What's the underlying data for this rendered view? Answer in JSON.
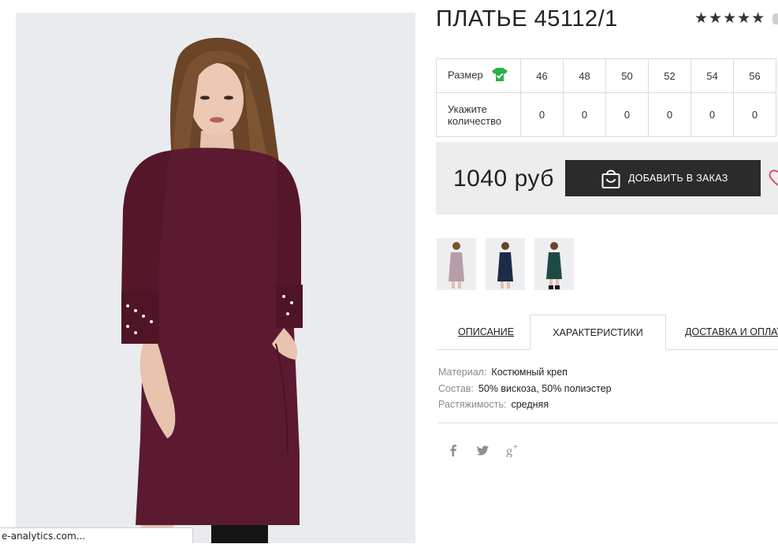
{
  "product": {
    "title": "ПЛАТЬЕ 45112/1",
    "rating_stars": "★★★★★",
    "rating_value": 5,
    "rating_max": 5
  },
  "size_table": {
    "size_label": "Размер",
    "qty_label_line1": "Укажите",
    "qty_label_line2": "количество",
    "sizes": [
      "46",
      "48",
      "50",
      "52",
      "54",
      "56"
    ],
    "quantities": [
      "0",
      "0",
      "0",
      "0",
      "0",
      "0"
    ],
    "size_icon": "tshirt-check-icon"
  },
  "purchase": {
    "price": "1040 руб",
    "add_button_label": "ДОБАВИТЬ В ЗАКАЗ",
    "add_button_icon": "shopping-bag-icon",
    "wishlist_icon": "heart-icon"
  },
  "thumbnails": [
    {
      "name": "thumb-mauve",
      "color": "#b59ea8"
    },
    {
      "name": "thumb-navy",
      "color": "#1f2a48"
    },
    {
      "name": "thumb-green",
      "color": "#1f4a44"
    }
  ],
  "tabs": [
    {
      "label": "ОПИСАНИЕ",
      "active": false
    },
    {
      "label": "ХАРАКТЕРИСТИКИ",
      "active": true
    },
    {
      "label": "ДОСТАВКА И ОПЛАТА",
      "active": false
    }
  ],
  "characteristics": [
    {
      "key": "Материал:",
      "value": "Костюмный креп"
    },
    {
      "key": "Состав:",
      "value": "50% вискоза, 50% полиэстер"
    },
    {
      "key": "Растяжимость:",
      "value": "средняя"
    }
  ],
  "social": [
    {
      "name": "facebook-icon",
      "glyph": "f"
    },
    {
      "name": "twitter-icon",
      "glyph": "🐦"
    },
    {
      "name": "google-plus-icon",
      "glyph": "g+"
    }
  ],
  "status_bar": {
    "text": "e-analytics.com..."
  },
  "colors": {
    "dress": "#5b1a30",
    "button_bg": "#2b2b2b",
    "price_box_bg": "#ededed",
    "size_icon_green": "#27b24a"
  }
}
